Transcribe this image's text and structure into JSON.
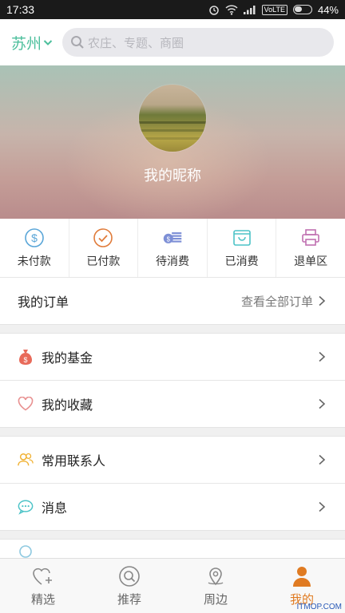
{
  "status_bar": {
    "time": "17:33",
    "network": "VoLTE",
    "battery": "44%"
  },
  "header": {
    "city": "苏州",
    "search_placeholder": "农庄、专题、商圈"
  },
  "profile": {
    "nickname": "我的昵称"
  },
  "order_status": [
    {
      "label": "未付款",
      "icon": "dollar-circle-icon"
    },
    {
      "label": "已付款",
      "icon": "check-circle-icon"
    },
    {
      "label": "待消费",
      "icon": "coin-stack-icon"
    },
    {
      "label": "已消费",
      "icon": "bag-icon"
    },
    {
      "label": "退单区",
      "icon": "printer-icon"
    }
  ],
  "orders": {
    "label": "我的订单",
    "view_all": "查看全部订单"
  },
  "menu": [
    {
      "label": "我的基金",
      "icon": "money-bag-icon"
    },
    {
      "label": "我的收藏",
      "icon": "heart-icon"
    },
    {
      "label": "常用联系人",
      "icon": "contacts-icon"
    },
    {
      "label": "消息",
      "icon": "message-icon"
    }
  ],
  "tabs": [
    {
      "label": "精选",
      "icon": "heart-plus-icon",
      "active": false
    },
    {
      "label": "推荐",
      "icon": "search-circle-icon",
      "active": false
    },
    {
      "label": "周边",
      "icon": "location-pin-icon",
      "active": false
    },
    {
      "label": "我的",
      "icon": "user-icon",
      "active": true
    }
  ],
  "colors": {
    "accent": "#4cbf9c",
    "active_tab": "#e07b22"
  },
  "watermark": "ITMOP.COM"
}
